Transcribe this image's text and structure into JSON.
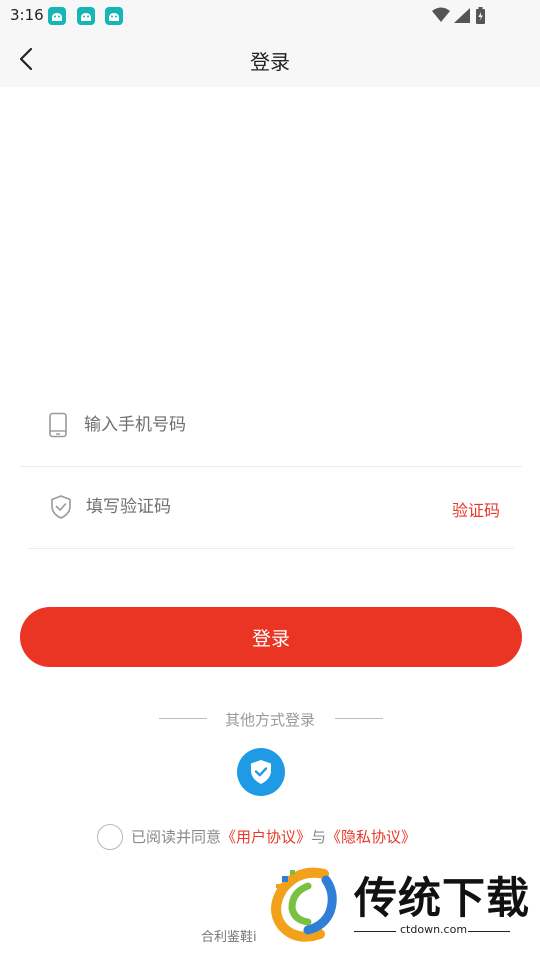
{
  "status_bar": {
    "time": "3:16",
    "notification_icons": [
      "android-notification-icon",
      "android-notification-icon",
      "android-notification-icon"
    ],
    "right_icons": [
      "wifi-icon",
      "cellular-signal-icon",
      "battery-charging-icon"
    ]
  },
  "header": {
    "title": "登录",
    "back_icon": "chevron-left-icon"
  },
  "form": {
    "phone": {
      "placeholder": "输入手机号码",
      "value": "",
      "icon": "phone-icon"
    },
    "code": {
      "placeholder": "填写验证码",
      "value": "",
      "icon": "shield-check-icon",
      "get_code_label": "验证码"
    }
  },
  "login_button": {
    "label": "登录"
  },
  "other_login": {
    "label": "其他方式登录",
    "oneclick_icon": "shield-check-icon"
  },
  "agreement": {
    "checked": false,
    "prefix": "已阅读并同意",
    "user_agreement": "《用户协议》",
    "conjunction": "与",
    "privacy_policy": "《隐私协议》"
  },
  "footer": {
    "text": "合利鉴鞋i"
  },
  "watermark": {
    "title": "传统下载",
    "url": "ctdown.com"
  },
  "colors": {
    "accent_red": "#ea3424",
    "link_red": "#e8382a",
    "oneclick_blue": "#1f9be6",
    "notification_teal": "#16b6b6"
  }
}
